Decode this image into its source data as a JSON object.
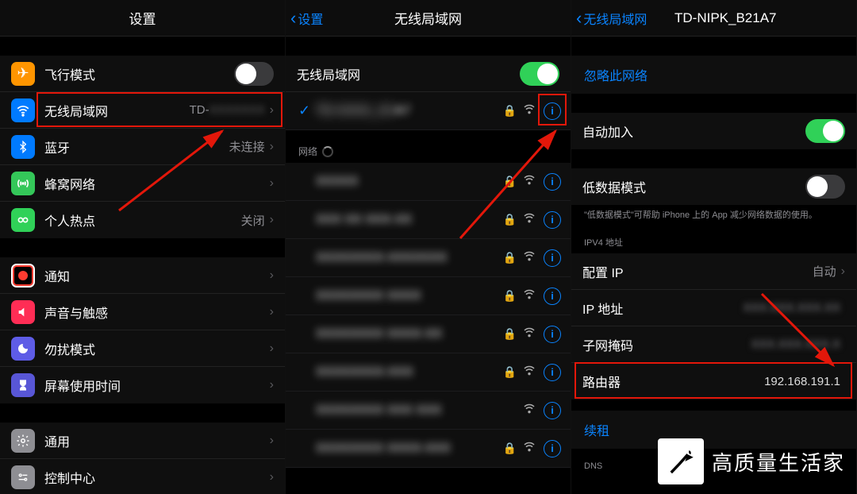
{
  "pane1": {
    "title": "设置",
    "airplane": "飞行模式",
    "wifi": "无线局域网",
    "wifi_value": "TD-",
    "bluetooth": "蓝牙",
    "bluetooth_value": "未连接",
    "cellular": "蜂窝网络",
    "hotspot": "个人热点",
    "hotspot_value": "关闭",
    "notif": "通知",
    "sound": "声音与触感",
    "dnd": "勿扰模式",
    "screentime": "屏幕使用时间",
    "general": "通用",
    "control": "控制中心"
  },
  "pane2": {
    "back": "设置",
    "title": "无线局域网",
    "toggle_label": "无线局域网",
    "connected_suffix": "A7",
    "section_networks": "网络"
  },
  "pane3": {
    "back": "无线局域网",
    "title": "TD-NIPK_B21A7",
    "forget": "忽略此网络",
    "autojoin": "自动加入",
    "lowdata": "低数据模式",
    "lowdata_hint": "\"低数据模式\"可帮助 iPhone 上的 App 减少网络数据的使用。",
    "ipv4_hdr": "IPV4 地址",
    "configure_ip": "配置 IP",
    "configure_ip_value": "自动",
    "ip_addr": "IP 地址",
    "subnet": "子网掩码",
    "router": "路由器",
    "router_value": "192.168.191.1",
    "renew": "续租",
    "dns_hdr": "DNS"
  },
  "watermark": "高质量生活家"
}
